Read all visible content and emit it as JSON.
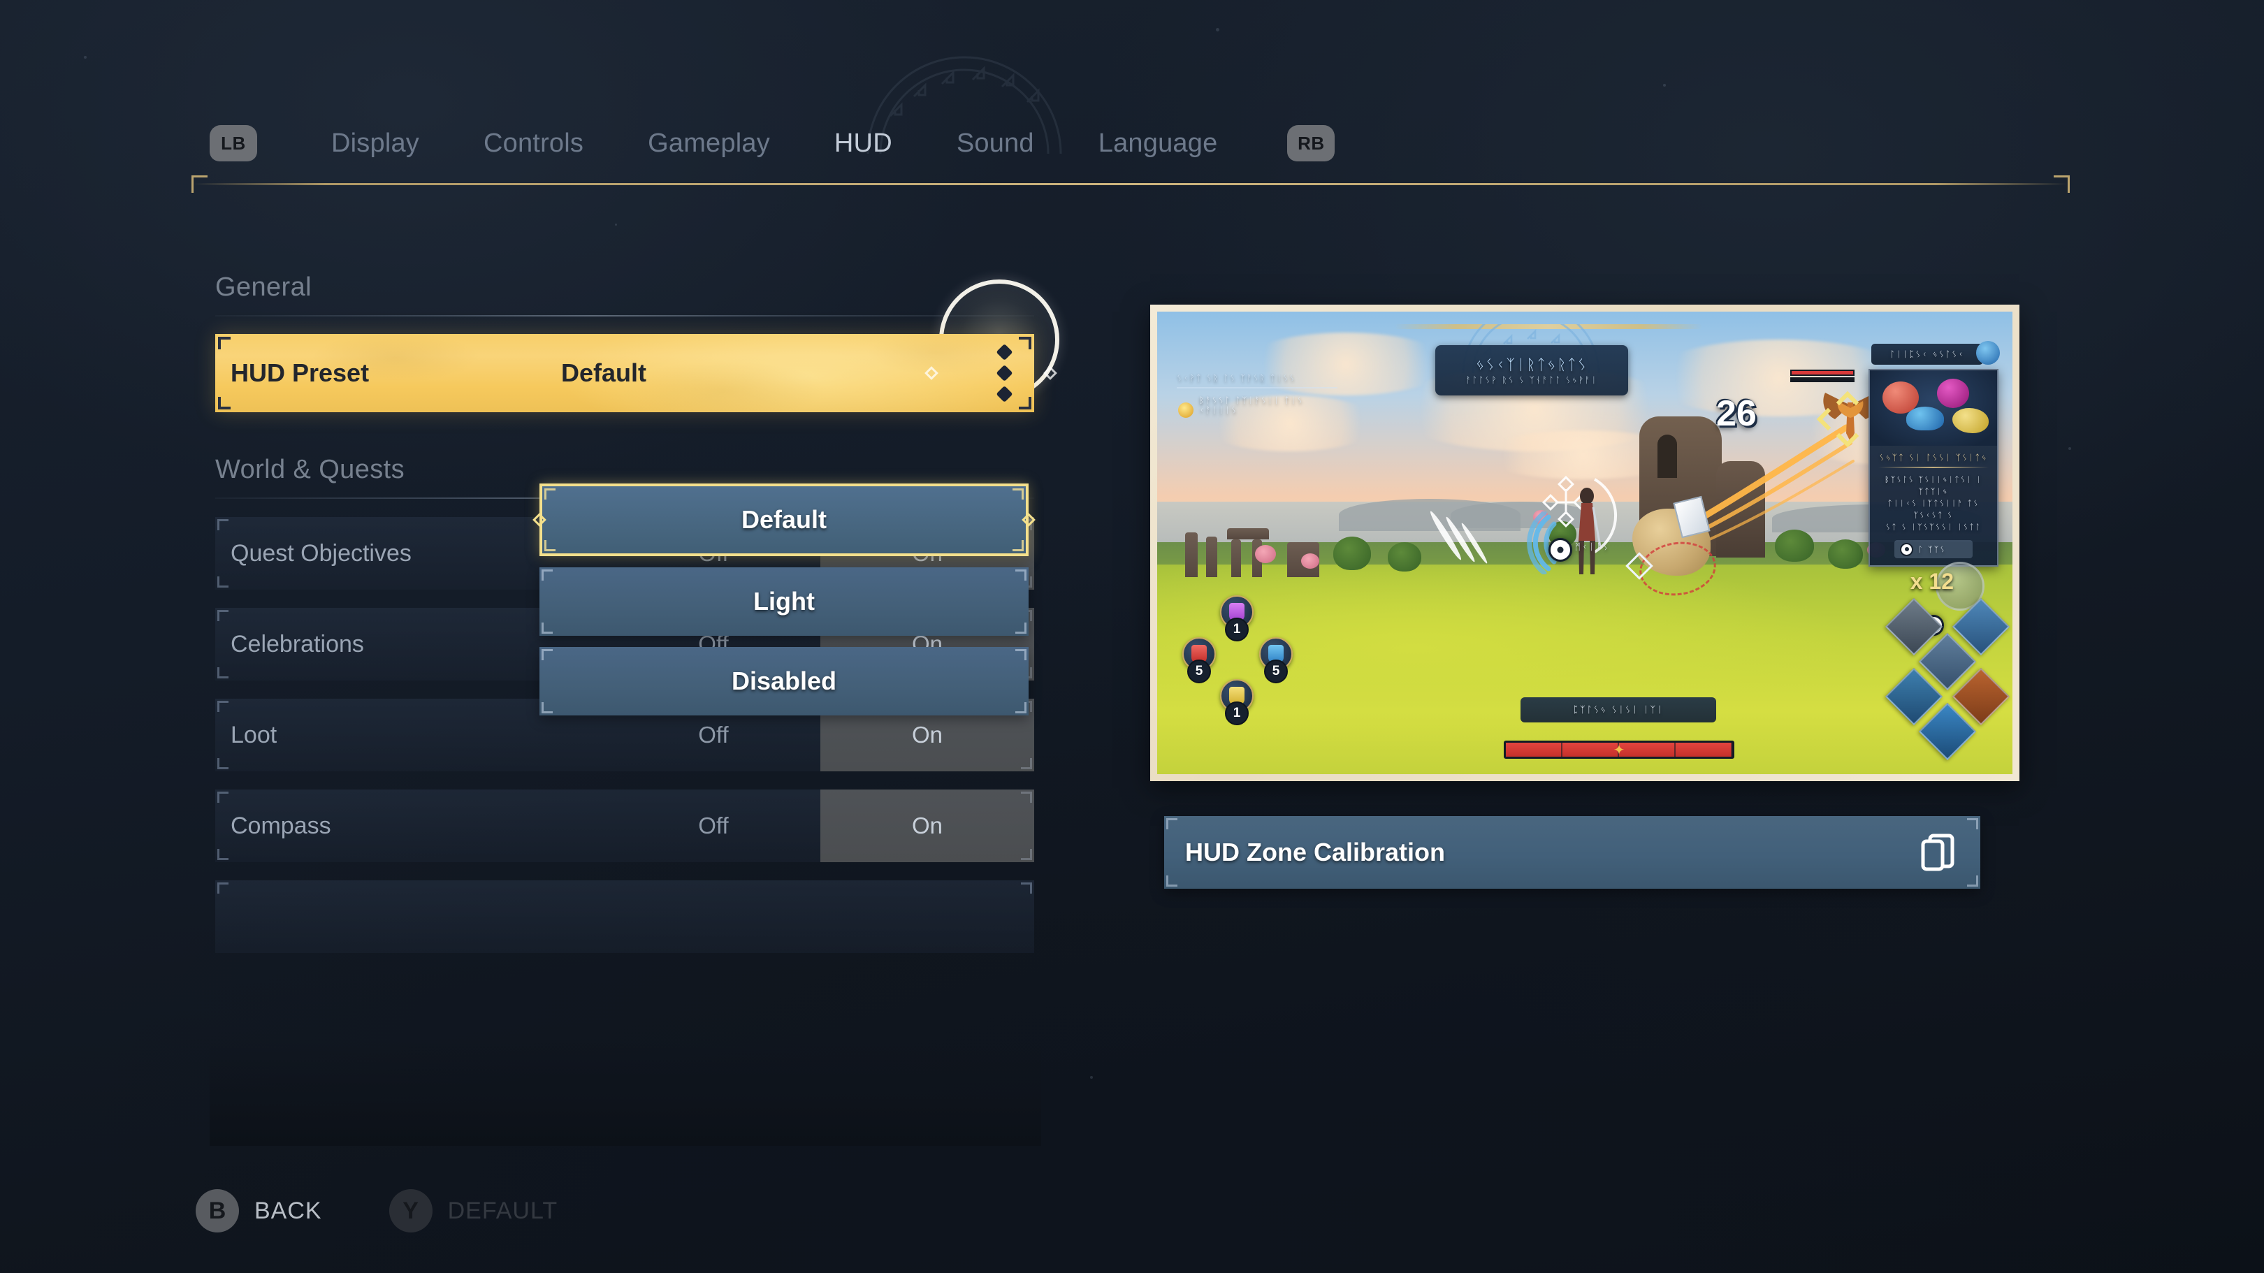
{
  "header": {
    "shoulder_left": "LB",
    "shoulder_right": "RB",
    "tabs": [
      {
        "label": "Display",
        "active": false
      },
      {
        "label": "Controls",
        "active": false
      },
      {
        "label": "Gameplay",
        "active": false
      },
      {
        "label": "HUD",
        "active": true
      },
      {
        "label": "Sound",
        "active": false
      },
      {
        "label": "Language",
        "active": false
      }
    ]
  },
  "settings": {
    "sections": [
      {
        "title": "General"
      },
      {
        "title": "World & Quests"
      }
    ],
    "general": {
      "hud_preset": {
        "label": "HUD Preset",
        "value": "Default",
        "more_indicator": "three-diamonds"
      }
    },
    "world_quests": {
      "rows": [
        {
          "label": "Quest Objectives",
          "options": [
            "Off",
            "On"
          ],
          "selected": "On"
        },
        {
          "label": "Celebrations",
          "options": [
            "Off",
            "On"
          ],
          "selected": "On"
        },
        {
          "label": "Loot",
          "options": [
            "Off",
            "On"
          ],
          "selected": "On"
        },
        {
          "label": "Compass",
          "options": [
            "Off",
            "On"
          ],
          "selected": "On"
        }
      ]
    }
  },
  "dropdown": {
    "open": true,
    "options": [
      {
        "label": "Default",
        "selected": true
      },
      {
        "label": "Light",
        "selected": false
      },
      {
        "label": "Disabled",
        "selected": false
      }
    ]
  },
  "preview": {
    "calibration_button": {
      "label": "HUD Zone Calibration",
      "icon": "screen-calibration-icon"
    },
    "hud_elements": {
      "quest_banner_title": "ᛃᛊᚲᛉᛁᚱᛏᛃᚱᛏᛊ",
      "quest_banner_subtitle": "ᚨᛚᛚᛊᚹ ᚱᛊ ᛊ ᛉᚾᚨᛚᛚ ᛊᛃᚹᚨᛁ",
      "objective_line1": "ᛊᚲᚹᛏ ᛊᚱ ᛚᛊ ᛉᚨᛊᚱ ᛏᛁᛊᛊ",
      "objective_line2": "ᛒᚨᛊᛊᛚ ᛚᛉᛁᚨᛊᛁᛁ ᛏᛁᛊ ᚲᚨᛁᛁᛁᛊ",
      "damage_number": "26",
      "interact_label": "ᛗᚲᛁᛁᛊ",
      "ability_bar_text": "ᛈᛉᛚᛊᛃ  ᛊᛁᛊᛁ ᛁᛉᛁ",
      "item_header_text": "ᛚᛁᛁᛈᛊᚲ ᛃᛊᛚᛊᚲ",
      "item_title": "ᛊᛃᛉᛏ ᛊᛁ ᛚᛊᛊᛁ ᛉᛊᛁᛏᛃ",
      "item_desc_line1": "ᛒᛉᛊᛚᛊ ᛉᛊᛁᛁᛃᛁᛏᛊᛁ ᛁ ᛉᛏᛉᛁᛃ",
      "item_desc_line2": "ᛏᛁᛁᚲᛊ ᛁᛉᛏᛊᛁᛁᚨ ᛏᛊ ᛉᛊᚲᛊᛏ ᛊ",
      "item_desc_line3": "ᛊᛏ ᛊ ᛁᛉᛊᛉᛊᛊᛁ ᛁᛊᛏᛚ",
      "item_button_text": "ᛚ ᛉᛉᛊ",
      "item_count": "x 12",
      "bottom_hint_text": "ᛁᛏᛉᛉ",
      "potions": [
        {
          "position": "top",
          "count": "1",
          "color": "#b44fd8"
        },
        {
          "position": "left",
          "count": "5",
          "color": "#d63c3c"
        },
        {
          "position": "right",
          "count": "5",
          "color": "#4a9ce0"
        },
        {
          "position": "bottom",
          "count": "1",
          "color": "#e3c64a"
        }
      ]
    }
  },
  "prompts": [
    {
      "button": "B",
      "label": "BACK",
      "enabled": true
    },
    {
      "button": "Y",
      "label": "DEFAULT",
      "enabled": false
    }
  ],
  "colors": {
    "accent_gold": "#f6c95d",
    "panel_blue": "#42607a",
    "bg_dark": "#101620",
    "text_muted": "#9aa5b4"
  }
}
